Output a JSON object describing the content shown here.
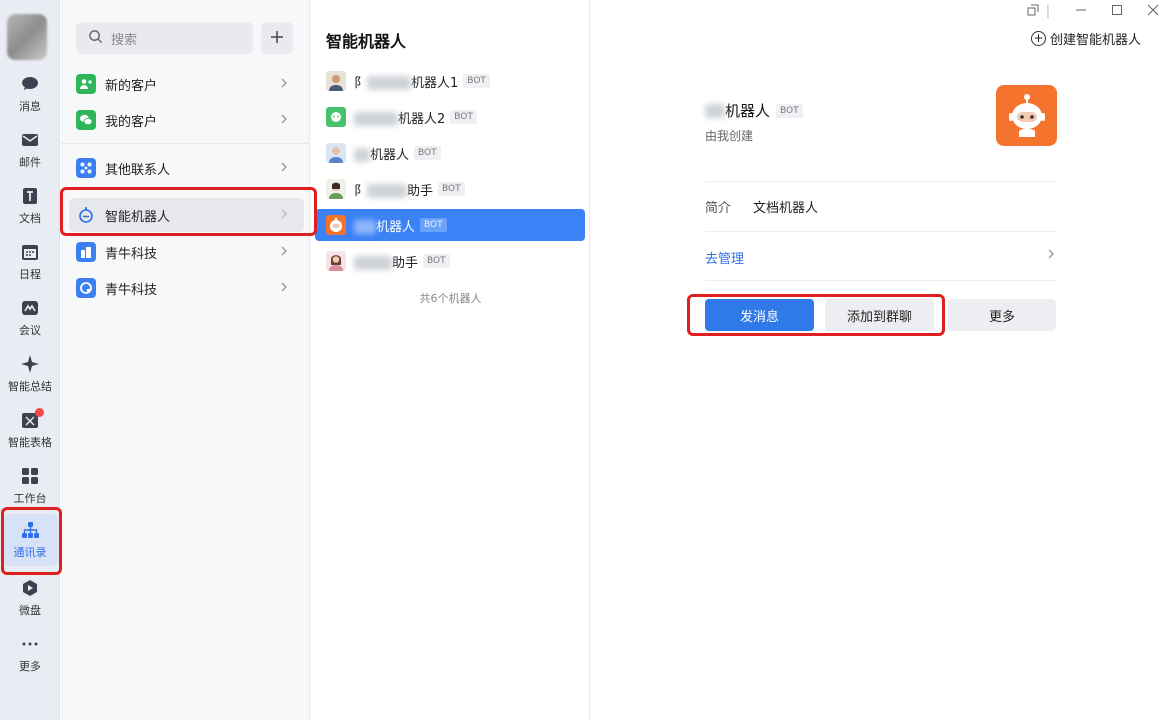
{
  "rail": {
    "items": [
      {
        "label": "消息",
        "icon": "chat-bubble-icon"
      },
      {
        "label": "邮件",
        "icon": "mail-icon"
      },
      {
        "label": "文档",
        "icon": "document-icon"
      },
      {
        "label": "日程",
        "icon": "calendar-icon"
      },
      {
        "label": "会议",
        "icon": "meeting-icon"
      },
      {
        "label": "智能总结",
        "icon": "sparkle-icon"
      },
      {
        "label": "智能表格",
        "icon": "smart-table-icon"
      },
      {
        "label": "工作台",
        "icon": "grid-icon"
      },
      {
        "label": "通讯录",
        "icon": "org-chart-icon"
      },
      {
        "label": "微盘",
        "icon": "cloud-drive-icon"
      },
      {
        "label": "更多",
        "icon": "more-dots-icon"
      }
    ]
  },
  "contacts": {
    "search_placeholder": "搜索",
    "items": [
      {
        "label": "新的客户"
      },
      {
        "label": "我的客户"
      },
      {
        "label": "其他联系人"
      },
      {
        "label": "智能机器人"
      },
      {
        "label": "青牛科技"
      },
      {
        "label": "青牛科技"
      }
    ]
  },
  "bots": {
    "title": "智能机器人",
    "badge": "BOT",
    "rows": [
      {
        "prefix": "阝",
        "suffix": "机器人1"
      },
      {
        "prefix": "",
        "suffix": "机器人2"
      },
      {
        "prefix": "",
        "suffix": "机器人"
      },
      {
        "prefix": "阝",
        "suffix": "助手"
      },
      {
        "prefix": "",
        "suffix": "机器人"
      },
      {
        "prefix": "",
        "suffix": "助手"
      }
    ],
    "total": "共6个机器人"
  },
  "detail": {
    "create_label": "创建智能机器人",
    "name": "机器人",
    "badge": "BOT",
    "subtitle": "由我创建",
    "intro_label": "简介",
    "intro_value": "文档机器人",
    "manage_label": "去管理",
    "buttons": {
      "send": "发消息",
      "add_group": "添加到群聊",
      "more": "更多"
    }
  },
  "colors": {
    "accent": "#2f7ae8",
    "highlight_box": "#e02020",
    "bot_avatar": "#f5742d"
  }
}
